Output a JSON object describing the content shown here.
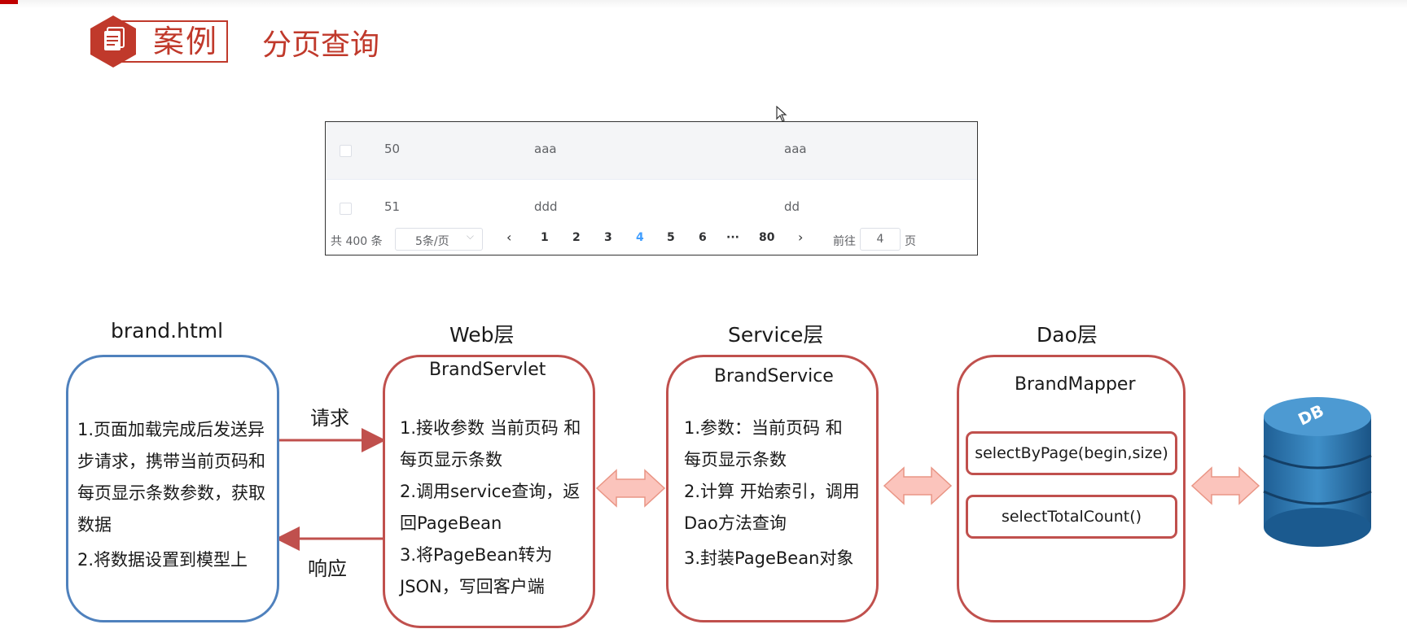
{
  "header": {
    "badge_label": "案例",
    "title": "分页查询",
    "badge_icon": "document-icon"
  },
  "table": {
    "rows": [
      {
        "id": "50",
        "brand": "aaa",
        "company": "aaa"
      },
      {
        "id": "51",
        "brand": "ddd",
        "company": "dd"
      }
    ],
    "pagination": {
      "total": "共 400 条",
      "page_size": "5条/页",
      "pages": [
        "1",
        "2",
        "3",
        "4",
        "5",
        "6",
        "···",
        "80"
      ],
      "current_page": "4",
      "prev_icon": "chevron-left-icon",
      "next_icon": "chevron-right-icon",
      "goto_label": "前往",
      "goto_value": "4",
      "page_suffix": "页"
    }
  },
  "diagram": {
    "layers": [
      {
        "title": "brand.html",
        "border_color": "#4f81bd",
        "lines": [
          "1.页面加载完成后发送异",
          "步请求，携带当前页码和",
          "每页显示条数参数，获取",
          "数据",
          "2.将数据设置到模型上"
        ]
      },
      {
        "title": "Web层",
        "box_title": "BrandServlet",
        "border_color": "#c0504d",
        "lines": [
          "1.接收参数 当前页码 和",
          "每页显示条数",
          "2.调用service查询，返",
          "回PageBean",
          "3.将PageBean转为",
          "JSON，写回客户端"
        ]
      },
      {
        "title": "Service层",
        "box_title": "BrandService",
        "border_color": "#c0504d",
        "lines": [
          "1.参数：当前页码 和",
          "每页显示条数",
          "2.计算 开始索引，调用",
          "Dao方法查询",
          "3.封装PageBean对象"
        ]
      },
      {
        "title": "Dao层",
        "box_title": "BrandMapper",
        "border_color": "#c0504d",
        "methods": [
          "selectByPage(begin,size)",
          "selectTotalCount()"
        ]
      }
    ],
    "request_label": "请求",
    "response_label": "响应",
    "database_label": "DB",
    "database_icon": "database-icon",
    "arrow_color": "#c0504d",
    "double_arrow_fill": "#fbc4bc"
  }
}
